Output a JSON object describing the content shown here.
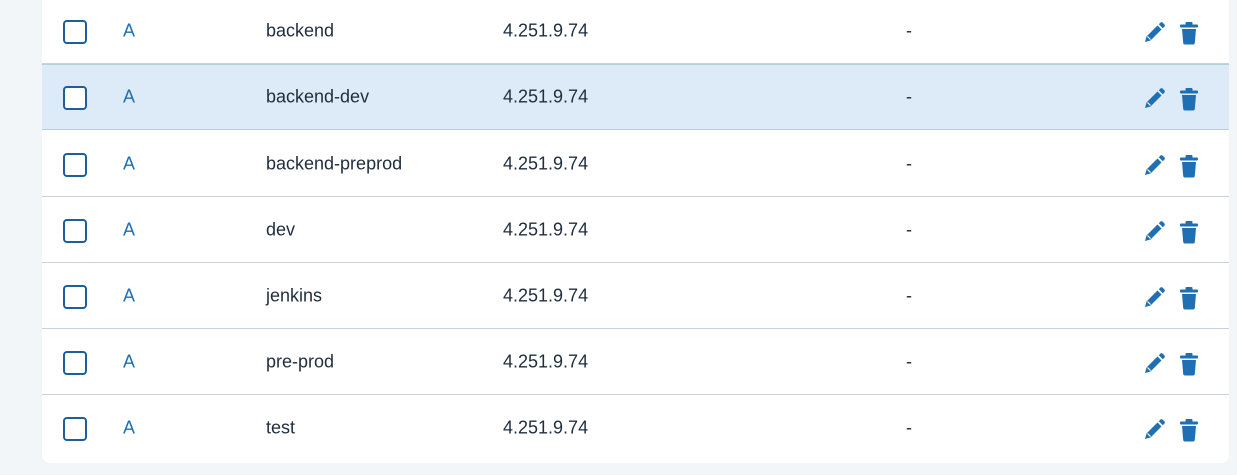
{
  "colors": {
    "accent": "#1f6fb5",
    "highlight_row": "#dcebf7",
    "page_background": "#f3f6f9"
  },
  "records": [
    {
      "type": "A",
      "name": "backend",
      "value": "4.251.9.74",
      "ttl": "-",
      "highlighted": false
    },
    {
      "type": "A",
      "name": "backend-dev",
      "value": "4.251.9.74",
      "ttl": "-",
      "highlighted": true
    },
    {
      "type": "A",
      "name": "backend-preprod",
      "value": "4.251.9.74",
      "ttl": "-",
      "highlighted": false
    },
    {
      "type": "A",
      "name": "dev",
      "value": "4.251.9.74",
      "ttl": "-",
      "highlighted": false
    },
    {
      "type": "A",
      "name": "jenkins",
      "value": "4.251.9.74",
      "ttl": "-",
      "highlighted": false
    },
    {
      "type": "A",
      "name": "pre-prod",
      "value": "4.251.9.74",
      "ttl": "-",
      "highlighted": false
    },
    {
      "type": "A",
      "name": "test",
      "value": "4.251.9.74",
      "ttl": "-",
      "highlighted": false
    }
  ],
  "row_actions": {
    "edit_icon": "pencil-icon",
    "delete_icon": "trash-icon"
  }
}
